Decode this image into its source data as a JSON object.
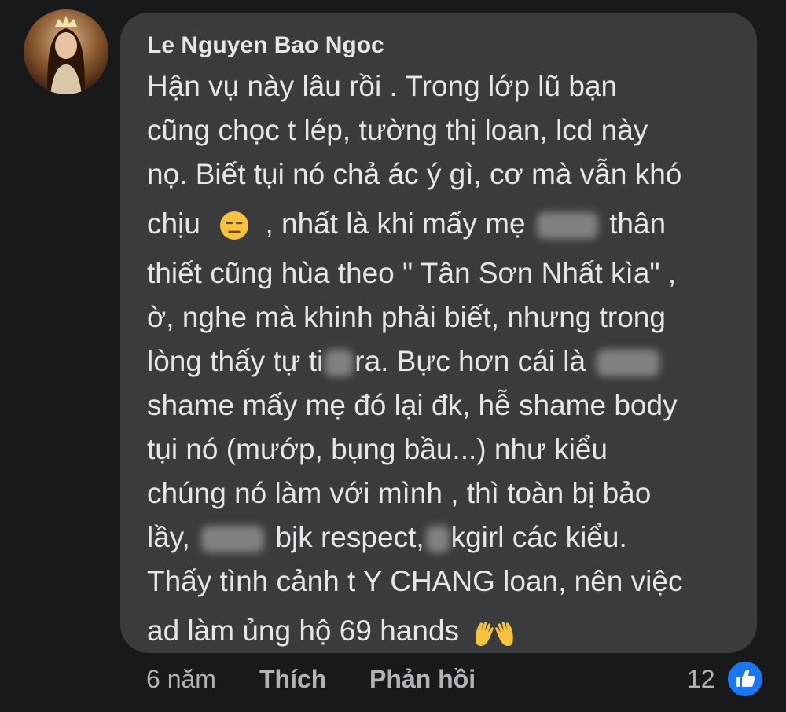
{
  "comment": {
    "author": "Le Nguyen Bao Ngoc",
    "lines": [
      "Hận vụ này lâu rồi . Trong lớp lũ bạn",
      "cũng chọc t lép, tường thị loan, lcd này",
      "nọ. Biết tụi nó chả ác ý gì, cơ mà vẫn khó"
    ],
    "line4": {
      "a": "chịu",
      "b": ", nhất là khi mấy mẹ",
      "c": "thân"
    },
    "line5": "thiết cũng hùa theo \" Tân Sơn Nhất kìa\" ,",
    "line6": "ờ, nghe mà khinh phải biết, nhưng trong",
    "line7": {
      "a": "lòng thấy tự ti",
      "b": "ra. Bực hơn cái là"
    },
    "lines2": [
      "shame mấy mẹ đó lại đk, hễ shame body",
      "tụi nó (mướp, bụng bầu...) như kiểu",
      "chúng nó làm với mình , thì toàn bị bảo"
    ],
    "line11": {
      "a": "lầy,",
      "b": "bjk respect,",
      "c": "kgirl các kiểu."
    },
    "line12": "Thấy tình cảnh t Y CHANG loan, nên việc",
    "line13": "ad làm ủng hộ 69 hands",
    "icons": {
      "face": "expressionless-face-emoji",
      "hands": "raising-hands-emoji",
      "like": "thumbs-up-icon"
    }
  },
  "footer": {
    "time": "6 năm",
    "like_label": "Thích",
    "reply_label": "Phản hồi",
    "reaction_count": "12"
  },
  "colors": {
    "background": "#18191a",
    "bubble": "#3a3b3c",
    "text": "#e4e6eb",
    "secondary": "#b0b3b8",
    "like_blue": "#1877f2"
  }
}
